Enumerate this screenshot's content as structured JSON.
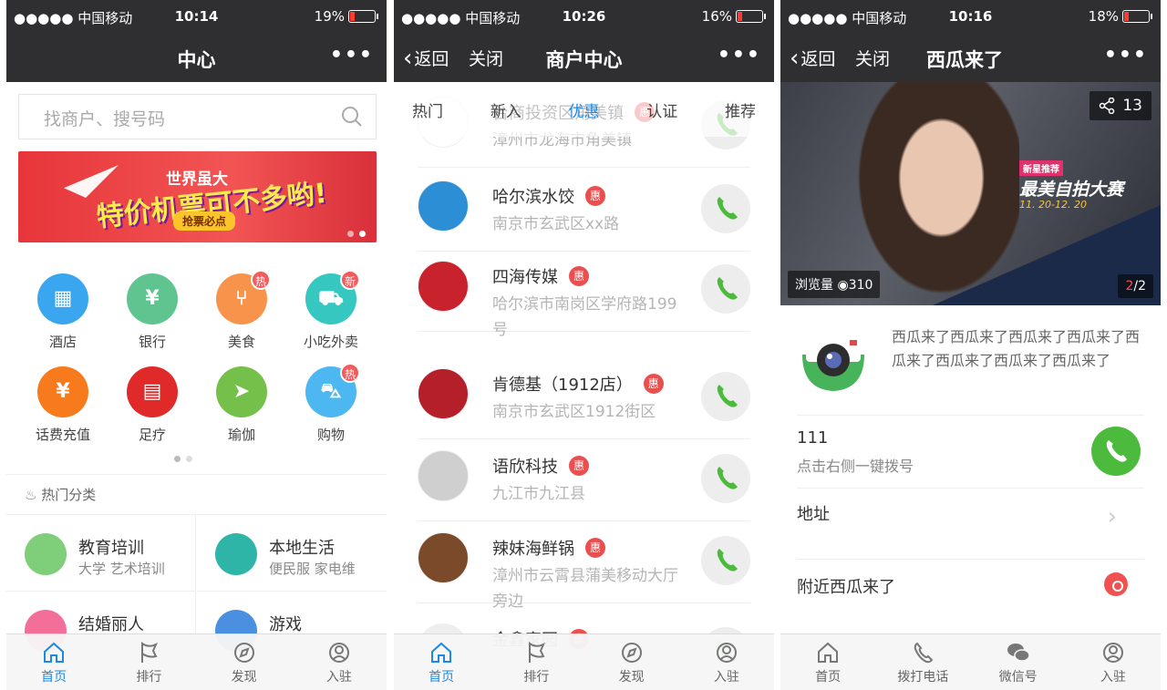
{
  "status": {
    "carrier": "●●●●● 中国移动",
    "p1": {
      "time": "10:14",
      "battery": "19%"
    },
    "p2": {
      "time": "10:26",
      "battery": "16%"
    },
    "p3": {
      "time": "10:16",
      "battery": "18%"
    }
  },
  "p1": {
    "nav_title": "中心",
    "more": "•••",
    "search_placeholder": "找商户、搜号码",
    "banner": {
      "line1": "世界虽大",
      "line2": "特价机票可不多哟!",
      "cta": "抢票必点"
    },
    "grid": [
      {
        "label": "酒店",
        "color": "#3aa6ef",
        "badge": ""
      },
      {
        "label": "银行",
        "color": "#5fc48f",
        "badge": ""
      },
      {
        "label": "美食",
        "color": "#f7934a",
        "badge": "热"
      },
      {
        "label": "小吃外卖",
        "color": "#35c7c0",
        "badge": "新"
      },
      {
        "label": "话费充值",
        "color": "#f77a1c",
        "badge": ""
      },
      {
        "label": "足疗",
        "color": "#e02a2a",
        "badge": ""
      },
      {
        "label": "瑜伽",
        "color": "#74c04b",
        "badge": ""
      },
      {
        "label": "购物",
        "color": "#4cb7f0",
        "badge": "热"
      }
    ],
    "hot_title": "热门分类",
    "categories": [
      {
        "title": "教育培训",
        "sub": "大学  艺术培训",
        "color": "#7fce7a"
      },
      {
        "title": "本地生活",
        "sub": "便民服  家电维",
        "color": "#2fb5a8"
      },
      {
        "title": "结婚丽人",
        "sub": "",
        "color": "#f46e9a"
      },
      {
        "title": "游戏",
        "sub": "",
        "color": "#4a8fe0"
      }
    ]
  },
  "p2": {
    "back": "返回",
    "close": "关闭",
    "nav_title": "商户中心",
    "tabs": [
      "热门",
      "新入",
      "优惠",
      "认证",
      "推荐"
    ],
    "active_tab": 2,
    "merchants": [
      {
        "name": "台商投资区角美镇",
        "addr": "漳州市龙海市角美镇",
        "logo": "#ffffff"
      },
      {
        "name": "哈尔滨水饺",
        "addr": "南京市玄武区xx路",
        "logo": "#2c8fd6"
      },
      {
        "name": "四海传媒",
        "addr": "哈尔滨市南岗区学府路199号",
        "logo": "#c8232c"
      },
      {
        "name": "肯德基（1912店）",
        "addr": "南京市玄武区1912街区",
        "logo": "#b41f2a"
      },
      {
        "name": "语欣科技",
        "addr": "九江市九江县",
        "logo": "#cfcfcf"
      },
      {
        "name": "辣妹海鲜锅",
        "addr": "漳州市云霄县蒲美移动大厅旁边",
        "logo": "#7a4a2a"
      },
      {
        "name": "金鑫家园",
        "addr": "",
        "logo": "#eeeeee"
      }
    ],
    "hui": "惠"
  },
  "p3": {
    "back": "返回",
    "close": "关闭",
    "nav_title": "西瓜来了",
    "share_count": "13",
    "hero_tag": "新星推荐",
    "hero_title": "最美自拍大赛",
    "hero_date": "11. 20-12. 20",
    "views_label": "浏览量",
    "views": "310",
    "page_cur": "2",
    "page_total": "/2",
    "desc": "西瓜来了西瓜来了西瓜来了西瓜来了西瓜来了西瓜来了西瓜来了西瓜来了",
    "phone": "111",
    "phone_hint": "点击右侧一键拨号",
    "address_label": "地址",
    "nearby_label": "附近西瓜来了"
  },
  "tabbar_main": [
    "首页",
    "排行",
    "发现",
    "入驻"
  ],
  "tabbar_detail": [
    "首页",
    "拨打电话",
    "微信号",
    "入驻"
  ],
  "colors": {
    "accent": "#1e88e5",
    "nav": "#2f2f31",
    "call_green": "#4cbb3d",
    "hui": "#ea4f4f"
  }
}
